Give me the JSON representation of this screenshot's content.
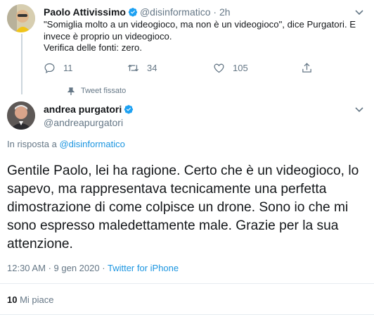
{
  "parent_tweet": {
    "name": "Paolo Attivissimo",
    "handle": "@disinformatico",
    "separator": "·",
    "time": "2h",
    "text": "\"Somiglia molto a un videogioco, ma non è un videogioco\", dice Purgatori. E invece è proprio un videogioco.",
    "text2": "Verifica delle fonti: zero.",
    "replies": "11",
    "retweets": "34",
    "likes": "105"
  },
  "pinned_label": "Tweet fissato",
  "main_tweet": {
    "name": "andrea purgatori",
    "handle": "@andreapurgatori",
    "reply_prefix": "In risposta a",
    "reply_to": "@disinformatico",
    "text": "Gentile Paolo, lei ha ragione. Certo che è un videogioco, lo sapevo, ma rappresentava tecnicamente una perfetta dimostrazione di come colpisce un drone. Sono io che mi sono espresso maledettamente male. Grazie per la sua attenzione.",
    "time": "12:30 AM",
    "date": "9 gen 2020",
    "source": "Twitter for iPhone",
    "likes_count": "10",
    "likes_label": "Mi piace"
  },
  "colors": {
    "verified": "#1da1f2",
    "link": "#1b95e0",
    "muted": "#657786"
  },
  "icons": [
    "verified-icon",
    "chevron-down-icon",
    "reply-icon",
    "retweet-icon",
    "heart-icon",
    "share-icon",
    "pin-icon"
  ]
}
